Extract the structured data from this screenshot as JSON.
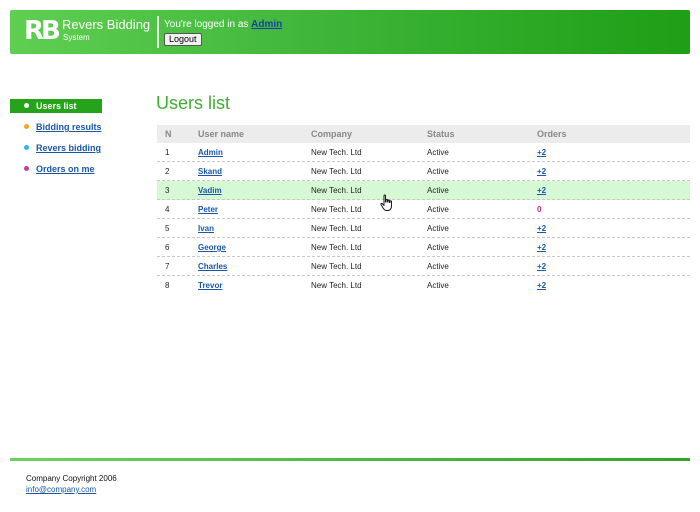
{
  "header": {
    "logo_mark": "RB",
    "title": "Revers Bidding",
    "subtitle": "System",
    "logged_in_text": "You're logged in as",
    "logged_in_user": "Admin",
    "logout_label": "Logout"
  },
  "sidebar": {
    "items": [
      {
        "label": "Users list",
        "dot_color": "#ffffff",
        "active": true
      },
      {
        "label": "Bidding results",
        "dot_color": "#f5a623"
      },
      {
        "label": "Revers bidding",
        "dot_color": "#2fb4e0"
      },
      {
        "label": "Orders on me",
        "dot_color": "#c0409a"
      }
    ]
  },
  "main": {
    "title": "Users list",
    "columns": {
      "n": "N",
      "user": "User name",
      "company": "Company",
      "status": "Status",
      "orders": "Orders"
    },
    "rows": [
      {
        "n": "1",
        "user": "Admin",
        "company": "New Tech. Ltd",
        "status": "Active",
        "orders": "+2"
      },
      {
        "n": "2",
        "user": "Skand",
        "company": "New Tech. Ltd",
        "status": "Active",
        "orders": "+2"
      },
      {
        "n": "3",
        "user": "Vadim",
        "company": "New Tech. Ltd",
        "status": "Active",
        "orders": "+2"
      },
      {
        "n": "4",
        "user": "Peter",
        "company": "New Tech. Ltd",
        "status": "Active",
        "orders": "0"
      },
      {
        "n": "5",
        "user": "Ivan",
        "company": "New Tech. Ltd",
        "status": "Active",
        "orders": "+2"
      },
      {
        "n": "6",
        "user": "George",
        "company": "New Tech. Ltd",
        "status": "Active",
        "orders": "+2"
      },
      {
        "n": "7",
        "user": "Charles",
        "company": "New Tech. Ltd",
        "status": "Active",
        "orders": "+2"
      },
      {
        "n": "8",
        "user": "Trevor",
        "company": "New Tech. Ltd",
        "status": "Active",
        "orders": "+2"
      }
    ]
  },
  "footer": {
    "copyright": "Company Copyright 2006",
    "email": "info@company.com"
  },
  "colors": {
    "brand_green": "#3fb63a",
    "highlight_row": "#d6f8d4",
    "link_blue": "#1a57a8",
    "zero_orders": "#c83282"
  }
}
